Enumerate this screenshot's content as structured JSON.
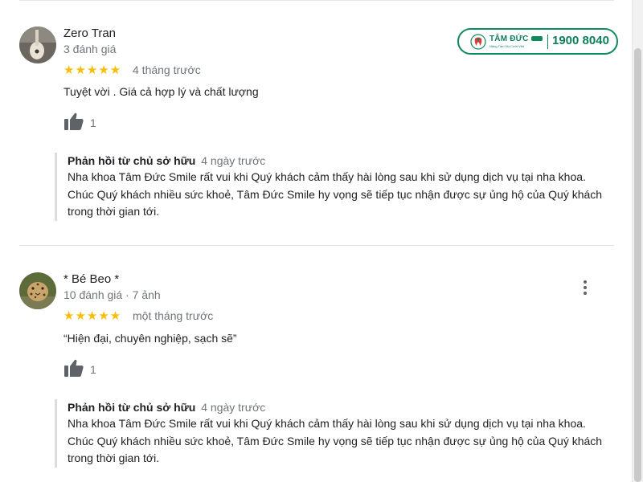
{
  "brand": {
    "name": "TÂM ĐỨC",
    "slogan": "Nâng Tầm Nụ Cười Việt",
    "phone": "1900 8040"
  },
  "reviews": [
    {
      "author": "Zero Tran",
      "meta": "3 đánh giá",
      "rating": 5,
      "stars": "★★★★★",
      "date": "4 tháng trước",
      "text": "Tuyệt vời . Giá cả hợp lý và chất lượng",
      "likes": "1",
      "reply": {
        "title": "Phản hồi từ chủ sở hữu",
        "date": "4 ngày trước",
        "body": "Nha khoa Tâm Đức Smile rất vui khi Quý khách cảm thấy hài lòng sau khi sử dụng dịch vụ tại nha khoa. Chúc Quý khách nhiều sức khoẻ, Tâm Đức Smile hy vọng sẽ tiếp tục nhận được sự ủng hộ của Quý khách trong thời gian tới."
      }
    },
    {
      "author": "* Bé Beo *",
      "meta": "10 đánh giá · 7 ảnh",
      "rating": 5,
      "stars": "★★★★★",
      "date": "một tháng trước",
      "text": "“Hiện đại, chuyên nghiệp, sạch sẽ”",
      "likes": "1",
      "reply": {
        "title": "Phản hồi từ chủ sở hữu",
        "date": "4 ngày trước",
        "body": "Nha khoa Tâm Đức Smile rất vui khi Quý khách cảm thấy hài lòng sau khi sử dụng dịch vụ tại nha khoa. Chúc Quý khách nhiều sức khoẻ, Tâm Đức Smile hy vọng sẽ tiếp tục nhận được sự ủng hộ của Quý khách trong thời gian tới."
      }
    }
  ],
  "colors": {
    "star": "#fbbc04",
    "brand_green": "#0d8b59",
    "muted_text": "#70757a"
  }
}
